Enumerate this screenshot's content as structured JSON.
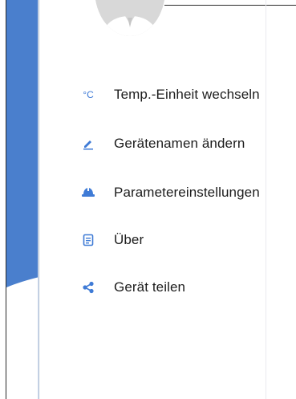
{
  "drawer": {
    "items": [
      {
        "label": "Temp.-Einheit wechseln",
        "icon": "temperature-celsius-icon"
      },
      {
        "label": "Gerätenamen ändern",
        "icon": "edit-pencil-icon"
      },
      {
        "label": "Parametereinstellungen",
        "icon": "hard-hat-icon"
      },
      {
        "label": "Über",
        "icon": "document-list-icon"
      },
      {
        "label": "Gerät teilen",
        "icon": "share-icon"
      }
    ],
    "temp_icon_text": "°C"
  },
  "colors": {
    "accent": "#3f7bd6",
    "panel_blue": "#4a7fcd",
    "avatar_bg": "#d8d8d8",
    "text": "#1c1c1c"
  }
}
